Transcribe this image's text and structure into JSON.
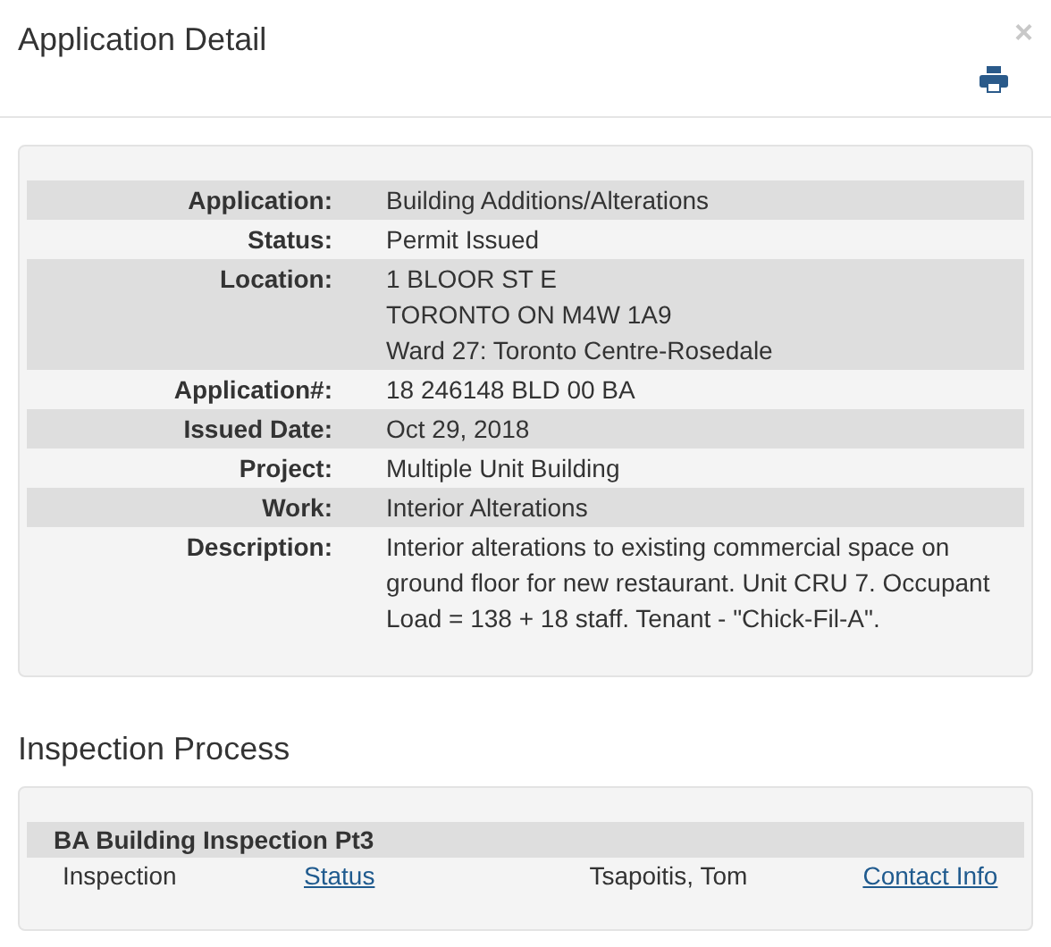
{
  "dialog": {
    "title": "Application Detail",
    "close": "×"
  },
  "details": [
    {
      "label": "Application:",
      "lines": [
        "Building Additions/Alterations"
      ]
    },
    {
      "label": "Status:",
      "lines": [
        "Permit Issued"
      ]
    },
    {
      "label": "Location:",
      "lines": [
        "1 BLOOR ST E",
        "TORONTO ON M4W 1A9",
        "Ward 27: Toronto Centre-Rosedale"
      ]
    },
    {
      "label": "Application#:",
      "lines": [
        "18 246148 BLD 00 BA"
      ]
    },
    {
      "label": "Issued Date:",
      "lines": [
        "Oct 29, 2018"
      ]
    },
    {
      "label": "Project:",
      "lines": [
        "Multiple Unit Building"
      ]
    },
    {
      "label": "Work:",
      "lines": [
        "Interior Alterations"
      ]
    },
    {
      "label": "Description:",
      "lines": [
        "Interior alterations to existing commercial space on ground floor for new restaurant. Unit CRU 7. Occupant Load = 138 + 18 staff. Tenant - \"Chick-Fil-A\"."
      ]
    }
  ],
  "inspection": {
    "heading": "Inspection Process",
    "group": "BA Building Inspection Pt3",
    "row": {
      "type": "Inspection",
      "status_link": "Status",
      "inspector": "Tsapoitis, Tom",
      "contact_link": "Contact Info"
    }
  }
}
